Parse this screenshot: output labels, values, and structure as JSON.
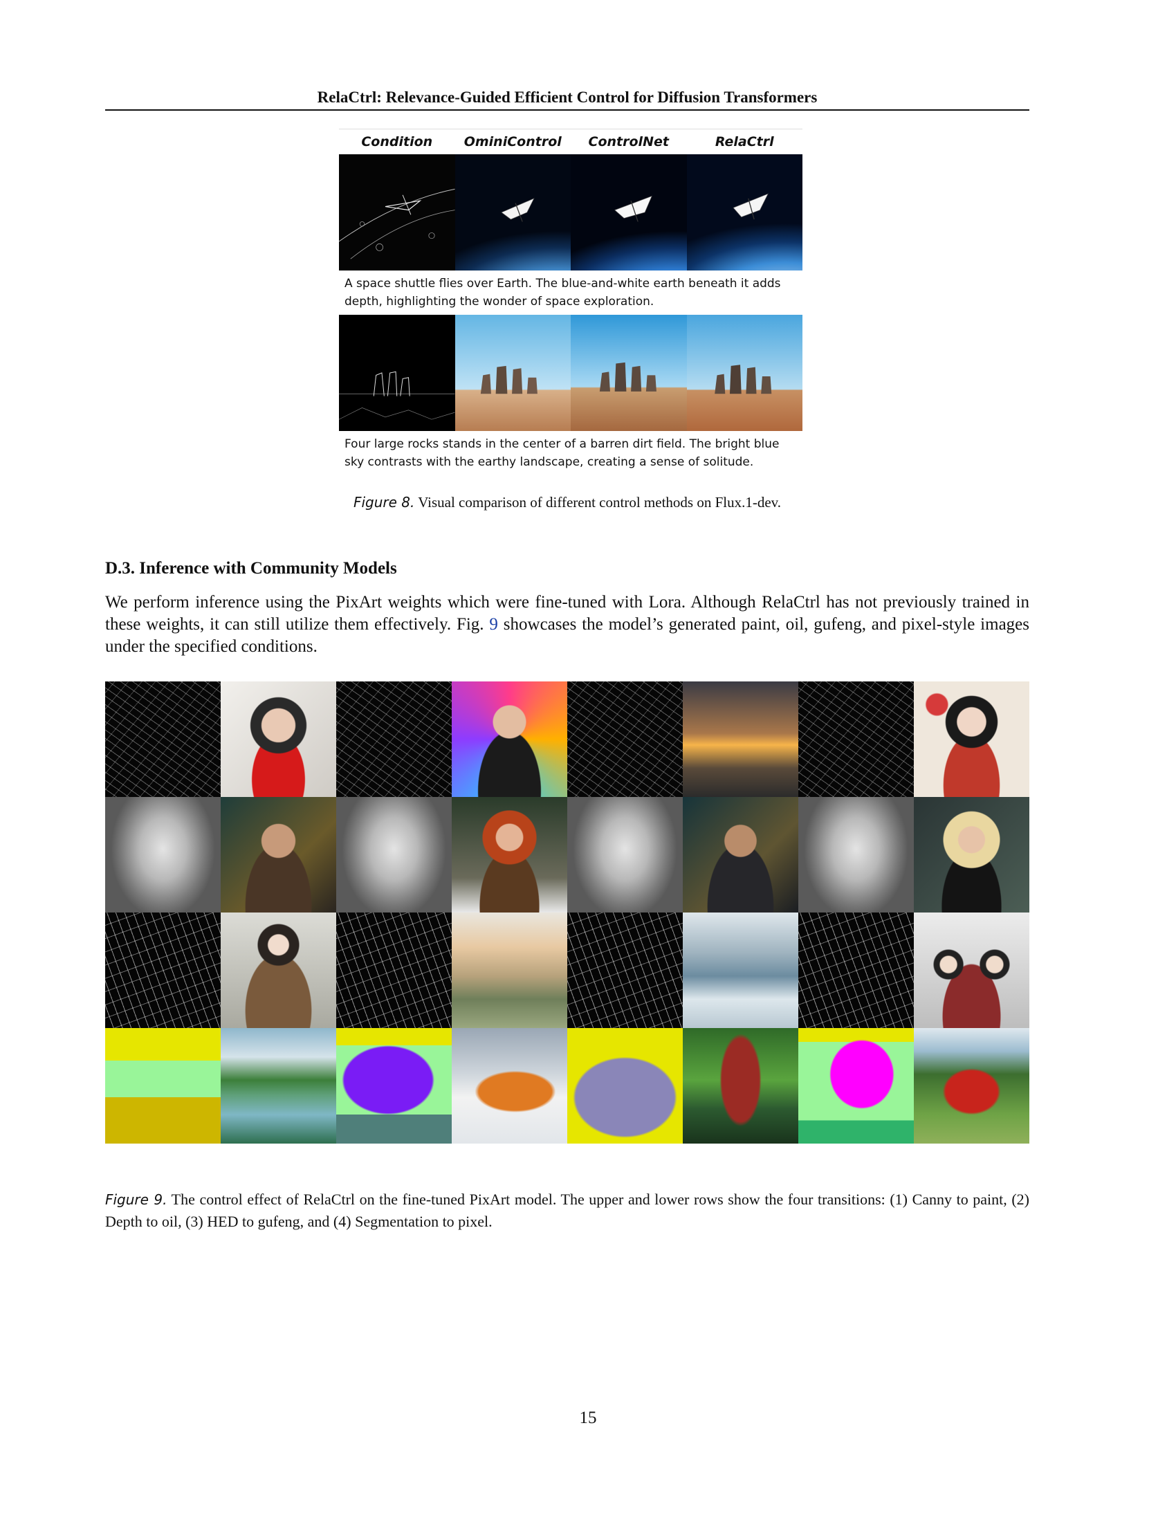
{
  "header": {
    "running_title": "RelaCtrl: Relevance-Guided Efficient Control for Diffusion Transformers"
  },
  "figure8": {
    "columns": [
      "Condition",
      "OminiControl",
      "ControlNet",
      "RelaCtrl"
    ],
    "rows": [
      {
        "caption": "A space shuttle flies over Earth. The blue-and-white earth beneath it adds depth, highlighting the wonder of space exploration."
      },
      {
        "caption": "Four large rocks stands in the center of a barren dirt field. The bright blue sky contrasts with the earthy landscape, creating a sense of solitude."
      }
    ],
    "caption_label": "Figure 8.",
    "caption_text": "Visual comparison of different control methods on Flux.1-dev."
  },
  "section": {
    "heading": "D.3. Inference with Community Models",
    "para_part1": "We perform inference using the PixArt weights which were fine-tuned with Lora. Although RelaCtrl has not previously trained in these weights, it can still utilize them effectively. Fig. ",
    "para_ref": "9",
    "para_part2": " showcases the model’s generated paint, oil, gufeng, and pixel-style images under the specified conditions."
  },
  "figure9": {
    "caption_label": "Figure 9.",
    "caption_text": "The control effect of RelaCtrl on the fine-tuned PixArt model. The upper and lower rows show the four transitions: (1) Canny to paint, (2) Depth to oil, (3) HED to gufeng, and (4) Segmentation to pixel."
  },
  "page_number": "15"
}
